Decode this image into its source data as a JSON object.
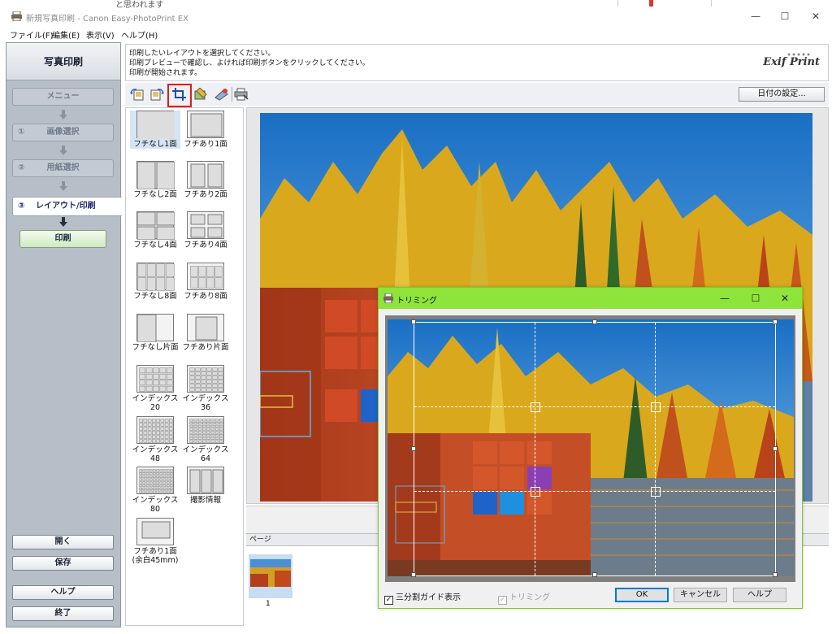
{
  "window": {
    "background_text": "と思われます",
    "title": "新規写真印刷 - Canon Easy-PhotoPrint EX",
    "minimize_glyph": "—",
    "maximize_glyph": "☐",
    "close_glyph": "✕"
  },
  "menu": {
    "file": "ファイル(F)",
    "edit": "編集(E)",
    "view": "表示(V)",
    "help": "ヘルプ(H)"
  },
  "sidebar": {
    "title": "写真印刷",
    "menu_label": "メニュー",
    "step1_num": "①",
    "step1_label": "画像選択",
    "step2_num": "②",
    "step2_label": "用紙選択",
    "step3_num": "③",
    "step3_label": "レイアウト/印刷",
    "print_label": "印刷",
    "open_label": "開く",
    "save_label": "保存",
    "help_label": "ヘルプ",
    "exit_label": "終了"
  },
  "instructions": {
    "line1": "印刷したいレイアウトを選択してください。",
    "line2": "印刷プレビューで確認し、よければ印刷ボタンをクリックしてください。",
    "line3": "印刷が開始されます。",
    "logo_a": "Exif",
    "logo_b": "Print"
  },
  "toolbar": {
    "date_settings": "日付の設定..."
  },
  "layouts": [
    {
      "label": "フチなし1面",
      "kind": "full1"
    },
    {
      "label": "フチあり1面",
      "kind": "bord1"
    },
    {
      "label": "フチなし2面",
      "kind": "full2"
    },
    {
      "label": "フチあり2面",
      "kind": "bord2"
    },
    {
      "label": "フチなし4面",
      "kind": "full4"
    },
    {
      "label": "フチあり4面",
      "kind": "bord4"
    },
    {
      "label": "フチなし8面",
      "kind": "full8"
    },
    {
      "label": "フチあり8面",
      "kind": "bord8"
    },
    {
      "label": "フチなし片面",
      "kind": "halfL"
    },
    {
      "label": "フチあり片面",
      "kind": "halfR"
    },
    {
      "label": "インデックス\n20",
      "kind": "idx20"
    },
    {
      "label": "インデックス\n36",
      "kind": "idx36"
    },
    {
      "label": "インデックス\n48",
      "kind": "idx48"
    },
    {
      "label": "インデックス\n64",
      "kind": "idx64"
    },
    {
      "label": "インデックス\n80",
      "kind": "idx80"
    },
    {
      "label": "撮影情報",
      "kind": "info"
    },
    {
      "label": "フチあり1面\n(余白45mm)",
      "kind": "bord45"
    }
  ],
  "pages": {
    "header": "ページ",
    "page1": "1"
  },
  "trimming": {
    "title": "トリミング",
    "guide_label": "三分割ガイド表示",
    "trim_label": "トリミング",
    "ok": "OK",
    "cancel": "キャンセル",
    "help": "ヘルプ",
    "check_mark": "✓"
  },
  "colors": {
    "accent_highlight": "#e21b1b",
    "dialog_title_bar": "#8ee43a",
    "sidebar_bg": "#b6bec8"
  }
}
